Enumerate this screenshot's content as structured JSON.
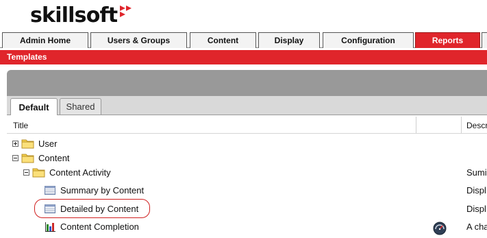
{
  "brand": {
    "name": "skillsoft",
    "accent": "#e0252b"
  },
  "nav_tabs": [
    {
      "label": "Admin Home"
    },
    {
      "label": "Users & Groups"
    },
    {
      "label": "Content"
    },
    {
      "label": "Display"
    },
    {
      "label": "Configuration"
    },
    {
      "label": "Reports",
      "active": true
    }
  ],
  "section_title": "Templates",
  "sub_tabs": [
    {
      "label": "Default",
      "active": true
    },
    {
      "label": "Shared"
    }
  ],
  "columns": {
    "title": "Title",
    "description": "Descr"
  },
  "tree": [
    {
      "label": "User",
      "type": "folder",
      "expander": "plus",
      "desc": ""
    },
    {
      "label": "Content",
      "type": "folder",
      "expander": "minus",
      "desc": ""
    },
    {
      "label": "Content Activity",
      "type": "folder",
      "expander": "minus",
      "desc": "Sumi"
    },
    {
      "label": "Summary by Content",
      "type": "table-report",
      "desc": "Displ"
    },
    {
      "label": "Detailed by Content",
      "type": "table-report",
      "desc": "Displ",
      "highlighted": true
    },
    {
      "label": "Content Completion",
      "type": "chart-report",
      "desc": "A cha"
    }
  ],
  "icons": {
    "folder": "folder-icon",
    "table_report": "table-report-icon",
    "chart_report": "bar-chart-icon",
    "gauge": "gauge-icon"
  }
}
